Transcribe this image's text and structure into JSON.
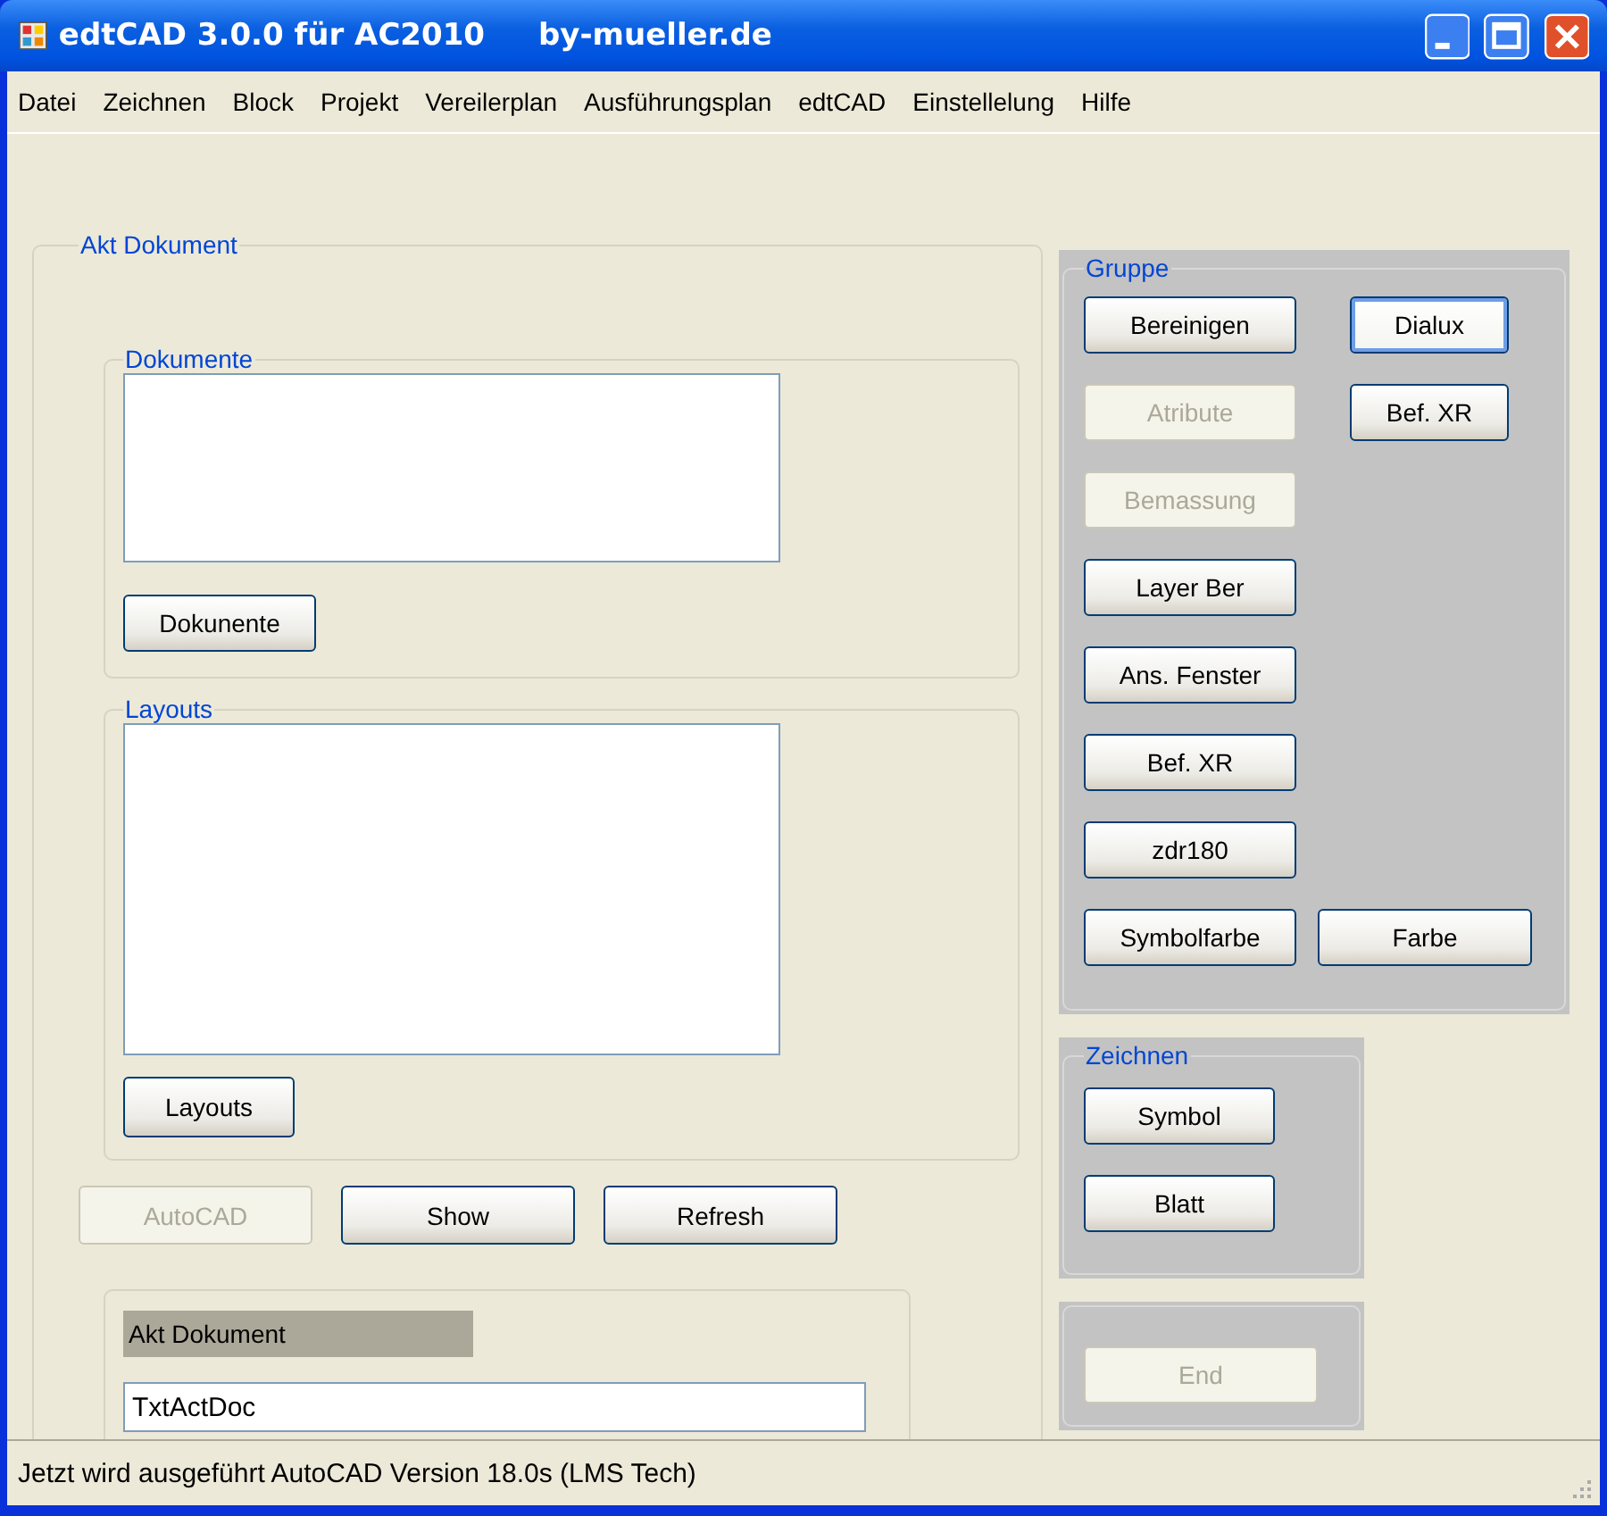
{
  "window": {
    "title": "edtCAD 3.0.0 für AC2010",
    "subtitle": "by-mueller.de"
  },
  "menu": [
    "Datei",
    "Zeichnen",
    "Block",
    "Projekt",
    "Vereilerplan",
    "Ausführungsplan",
    "edtCAD",
    "Einstellelung",
    "Hilfe"
  ],
  "akt_dokument_group": {
    "title": "Akt Dokument",
    "dokumente": {
      "title": "Dokumente",
      "button": {
        "label": "Dokunente",
        "disabled": false
      }
    },
    "layouts": {
      "title": "Layouts",
      "button": {
        "label": "Layouts",
        "disabled": false
      }
    },
    "buttons": [
      {
        "label": "AutoCAD",
        "disabled": true
      },
      {
        "label": "Show",
        "disabled": false
      },
      {
        "label": "Refresh",
        "disabled": false
      }
    ],
    "akt_dokument": {
      "label": "Akt Dokument",
      "value": "TxtActDoc"
    }
  },
  "gruppe": {
    "title": "Gruppe",
    "rows": [
      [
        {
          "label": "Bereinigen",
          "disabled": false,
          "focused": false
        },
        {
          "label": "Dialux",
          "disabled": false,
          "focused": true
        }
      ],
      [
        {
          "label": "Atribute",
          "disabled": true,
          "focused": false
        },
        {
          "label": "Bef. XR",
          "disabled": false,
          "focused": false
        }
      ],
      [
        {
          "label": "Bemassung",
          "disabled": true,
          "focused": false
        }
      ],
      [
        {
          "label": "Layer Ber",
          "disabled": false,
          "focused": false
        }
      ],
      [
        {
          "label": "Ans. Fenster",
          "disabled": false,
          "focused": false
        }
      ],
      [
        {
          "label": "Bef. XR",
          "disabled": false,
          "focused": false
        }
      ],
      [
        {
          "label": "zdr180",
          "disabled": false,
          "focused": false
        }
      ],
      [
        {
          "label": "Symbolfarbe",
          "disabled": false,
          "focused": false
        },
        {
          "label": "Farbe",
          "disabled": false,
          "focused": false
        }
      ]
    ]
  },
  "zeichnen": {
    "title": "Zeichnen",
    "buttons": [
      {
        "label": "Symbol",
        "disabled": false
      },
      {
        "label": "Blatt",
        "disabled": false
      }
    ]
  },
  "end_panel": {
    "buttons": [
      {
        "label": "End",
        "disabled": true
      }
    ]
  },
  "status_bar": "Jetzt wird ausgeführt AutoCAD Version 18.0s (LMS Tech)"
}
